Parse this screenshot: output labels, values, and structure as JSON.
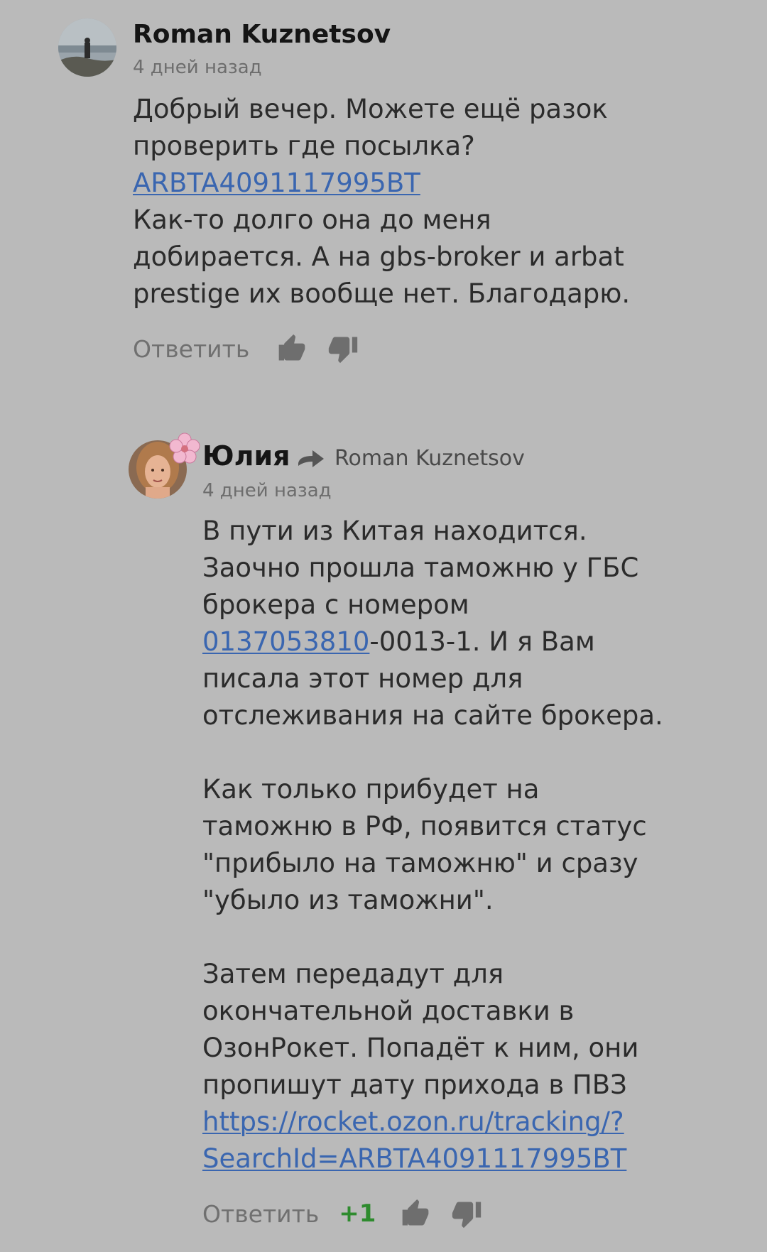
{
  "comments": [
    {
      "author": "Roman Kuznetsov",
      "time": "4 дней назад",
      "text": {
        "l1": "Добрый вечер. Можете ещё разок",
        "l2": "проверить где посылка?",
        "tracking_link": "ARBTA4091117995BT",
        "l4": "Как-то долго она до меня",
        "l5": "добирается. А на gbs-broker и arbat",
        "l6": "prestige их вообще нет. Благодарю."
      },
      "reply_label": "Ответить"
    },
    {
      "author": "Юлия",
      "reply_to": "Roman Kuznetsov",
      "time": "4 дней назад",
      "text": {
        "p1_l1": "В пути из Китая находится.",
        "p1_l2": "Заочно прошла таможню у ГБС",
        "p1_l3": "брокера с номером",
        "p1_number_link": "0137053810",
        "p1_l4_rest": "-0013-1. И я Вам",
        "p1_l5": "писала этот номер для",
        "p1_l6": "отслеживания на сайте брокера.",
        "p2_l1": "Как только прибудет на",
        "p2_l2": "таможню в РФ, появится статус",
        "p2_l3": "\"прибыло на таможню\" и сразу",
        "p2_l4": "\"убыло из таможни\".",
        "p3_l1": "Затем передадут для",
        "p3_l2": "окончательной доставки в",
        "p3_l3": "ОзонРокет. Попадёт к ним, они",
        "p3_l4": "пропишут дату прихода в ПВЗ",
        "p3_link_l1": "https://rocket.ozon.ru/tracking/?",
        "p3_link_l2": "SearchId=ARBTA4091117995BT"
      },
      "reply_label": "Ответить",
      "score": "+1"
    }
  ],
  "icons": {
    "like": "thumbs-up-icon",
    "dislike": "thumbs-down-icon",
    "reply_arrow": "reply-arrow-icon",
    "badge": "sakura-flower-icon"
  },
  "colors": {
    "background": "#bababa",
    "link": "#3a66b0",
    "score_positive": "#2e8b2e",
    "icon_gray": "#6e6e6e"
  }
}
